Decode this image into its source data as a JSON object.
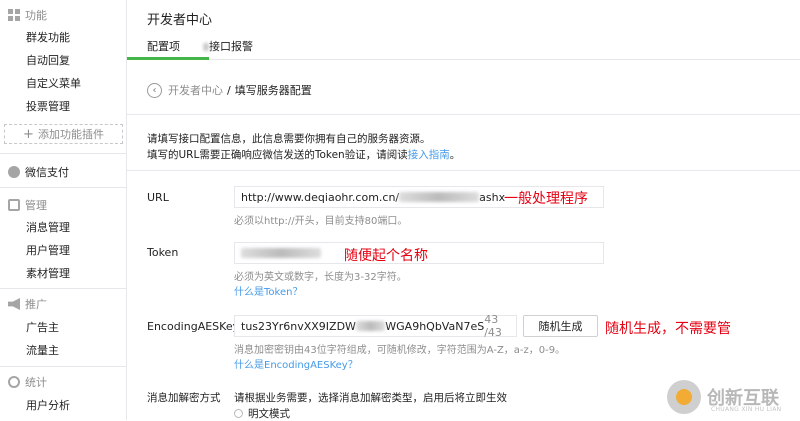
{
  "sidebar": {
    "sections": [
      {
        "title": "功能",
        "icon": "grid-icon"
      },
      {
        "title": "微信支付",
        "icon": "pay-icon"
      },
      {
        "title": "管理",
        "icon": "manage-icon"
      },
      {
        "title": "推广",
        "icon": "promote-icon"
      },
      {
        "title": "统计",
        "icon": "stats-icon"
      }
    ],
    "function_items": [
      "群发功能",
      "自动回复",
      "自定义菜单",
      "投票管理"
    ],
    "add_plugin": "添加功能插件",
    "manage_items": [
      "消息管理",
      "用户管理",
      "素材管理"
    ],
    "promote_items": [
      "广告主",
      "流量主"
    ],
    "stats_items": [
      "用户分析"
    ]
  },
  "header": {
    "title": "开发者中心",
    "tabs": [
      {
        "label": "配置项",
        "active": true
      },
      {
        "label": "接口报警",
        "active": false
      }
    ]
  },
  "breadcrumb": {
    "parent": "开发者中心",
    "separator": "/",
    "current": "填写服务器配置"
  },
  "intro": {
    "line1": "请填写接口配置信息，此信息需要你拥有自己的服务器资源。",
    "line2_prefix": "填写的URL需要正确响应微信发送的Token验证，请阅读",
    "line2_link": "接入指南",
    "line2_suffix": "。"
  },
  "form": {
    "url": {
      "label": "URL",
      "value_prefix": "http://www.deqiaohr.com.cn/",
      "value_suffix": "ashx",
      "hint": "必须以http://开头，目前支持80端口。",
      "annotation": "一般处理程序"
    },
    "token": {
      "label": "Token",
      "hint": "必须为英文或数字，长度为3-32字符。",
      "help_link": "什么是Token？",
      "annotation": "随便起个名称"
    },
    "aes_key": {
      "label": "EncodingAESKey",
      "value_prefix": "tus23Yr6nvXX9IZDW",
      "value_suffix": "WGA9hQbVaN7eS",
      "counter": "43 /43",
      "generate_button": "随机生成",
      "hint": "消息加密密钥由43位字符组成，可随机修改，字符范围为A-Z，a-z，0-9。",
      "help_link": "什么是EncodingAESKey？",
      "annotation": "随机生成，不需要管"
    },
    "encrypt": {
      "label": "消息加解密方式",
      "desc": "请根据业务需要，选择消息加解密类型，启用后将立即生效",
      "option1": "明文模式"
    }
  },
  "watermark": {
    "name": "创新互联",
    "sub": "CHUANG XIN HU LIAN"
  },
  "colors": {
    "accent": "#44b549",
    "link": "#459ae9",
    "annotation": "#e60012"
  }
}
